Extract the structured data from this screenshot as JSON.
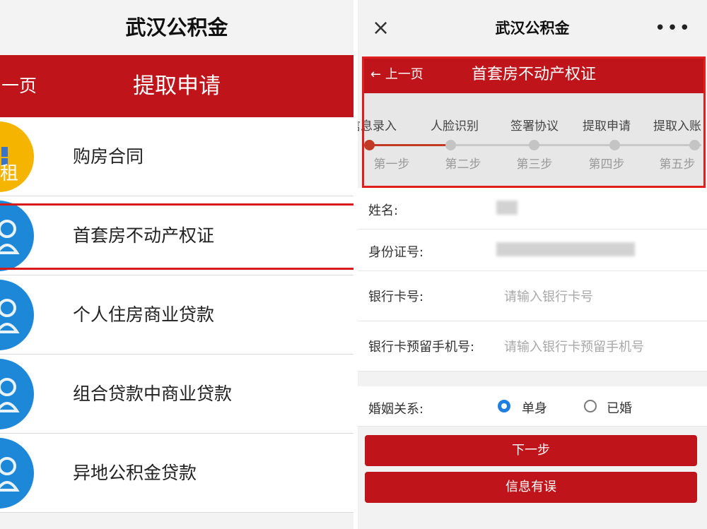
{
  "left": {
    "app_title": "武汉公积金",
    "back_label": "一页",
    "header_title": "提取申请",
    "menu_items": [
      {
        "label": "购房合同",
        "icon": "rent-icon",
        "badge_text": "租",
        "color": "#f4b400"
      },
      {
        "label": "首套房不动产权证",
        "icon": "person-icon",
        "color": "#1e88d8"
      },
      {
        "label": "个人住房商业贷款",
        "icon": "person-icon",
        "color": "#1e88d8"
      },
      {
        "label": "组合贷款中商业贷款",
        "icon": "person-icon",
        "color": "#1e88d8"
      },
      {
        "label": "异地公积金贷款",
        "icon": "person-icon",
        "color": "#1e88d8"
      }
    ]
  },
  "right": {
    "close_icon": "×",
    "app_title": "武汉公积金",
    "more_icon": "•••",
    "back_label": "上一页",
    "header_title": "首套房不动产权证",
    "steps": [
      {
        "name": "信息录入",
        "no": "第一步"
      },
      {
        "name": "人脸识别",
        "no": "第二步"
      },
      {
        "name": "签署协议",
        "no": "第三步"
      },
      {
        "name": "提取申请",
        "no": "第四步"
      },
      {
        "name": "提取入账",
        "no": "第五步"
      }
    ],
    "current_step": 1,
    "form": {
      "name_label": "姓名:",
      "id_label": "身份证号:",
      "card_label": "银行卡号:",
      "card_placeholder": "请输入银行卡号",
      "phone_label": "银行卡预留手机号:",
      "phone_placeholder": "请输入银行卡预留手机号",
      "marriage_label": "婚姻关系:",
      "option_single": "单身",
      "option_married": "已婚",
      "selected": "单身"
    },
    "next_button": "下一步",
    "error_button": "信息有误"
  },
  "colors": {
    "brand_red": "#c0141b",
    "highlight_red": "#e01e1e",
    "radio_blue": "#1e7fe0"
  }
}
